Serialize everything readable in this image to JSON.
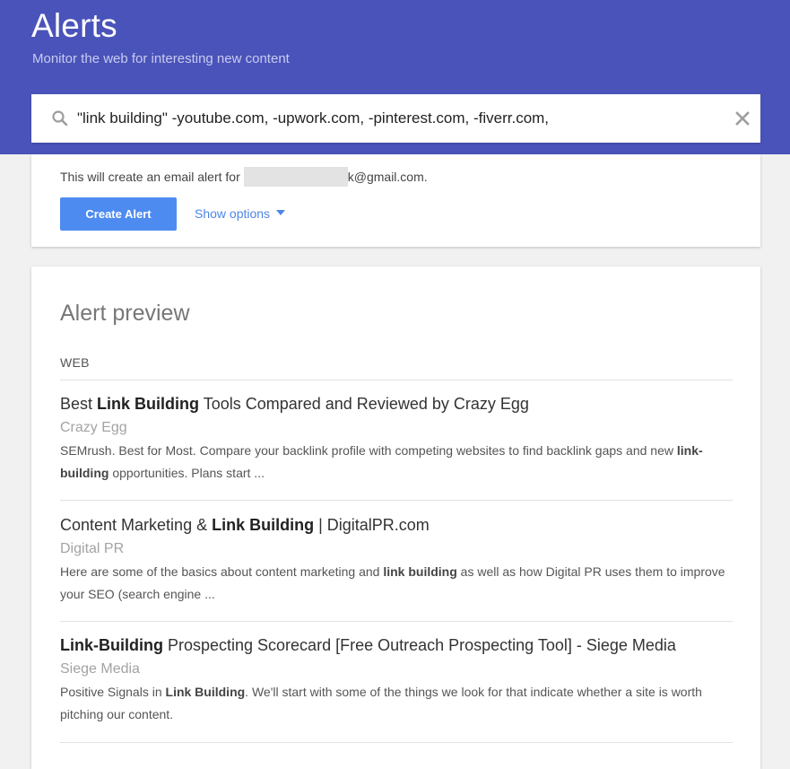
{
  "header": {
    "title": "Alerts",
    "subtitle": "Monitor the web for interesting new content",
    "bg_color": "#4a53b9"
  },
  "search": {
    "value": "\"link building\" -youtube.com, -upwork.com, -pinterest.com, -fiverr.com,",
    "search_icon": "search-icon",
    "clear_icon": "close-icon"
  },
  "create": {
    "email_prefix": "This will create an email alert for",
    "email_suffix": "k@gmail.com.",
    "button_label": "Create Alert",
    "button_color": "#4d8bf0",
    "show_options_label": "Show options",
    "show_options_icon": "caret-down-icon"
  },
  "preview": {
    "title": "Alert preview",
    "section_label": "WEB",
    "results": [
      {
        "title_parts": [
          {
            "text": "Best ",
            "bold": false
          },
          {
            "text": "Link Building",
            "bold": true
          },
          {
            "text": " Tools Compared and Reviewed by Crazy Egg",
            "bold": false
          }
        ],
        "source": "Crazy Egg",
        "snippet_parts": [
          {
            "text": "SEMrush. Best for Most. Compare your backlink profile with competing websites to find backlink gaps and new ",
            "bold": false
          },
          {
            "text": "link-building",
            "bold": true
          },
          {
            "text": " opportunities. Plans start ...",
            "bold": false
          }
        ]
      },
      {
        "title_parts": [
          {
            "text": "Content Marketing & ",
            "bold": false
          },
          {
            "text": "Link Building",
            "bold": true
          },
          {
            "text": " | DigitalPR.com",
            "bold": false
          }
        ],
        "source": "Digital PR",
        "snippet_parts": [
          {
            "text": "Here are some of the basics about content marketing and ",
            "bold": false
          },
          {
            "text": "link building",
            "bold": true
          },
          {
            "text": " as well as how Digital PR uses them to improve your SEO (search engine ...",
            "bold": false
          }
        ]
      },
      {
        "title_parts": [
          {
            "text": "Link-Building",
            "bold": true
          },
          {
            "text": " Prospecting Scorecard [Free Outreach Prospecting Tool] - Siege Media",
            "bold": false
          }
        ],
        "source": "Siege Media",
        "snippet_parts": [
          {
            "text": "Positive Signals in ",
            "bold": false
          },
          {
            "text": "Link Building",
            "bold": true
          },
          {
            "text": ". We'll start with some of the things we look for that indicate whether a site is worth pitching our content.",
            "bold": false
          }
        ]
      }
    ]
  }
}
